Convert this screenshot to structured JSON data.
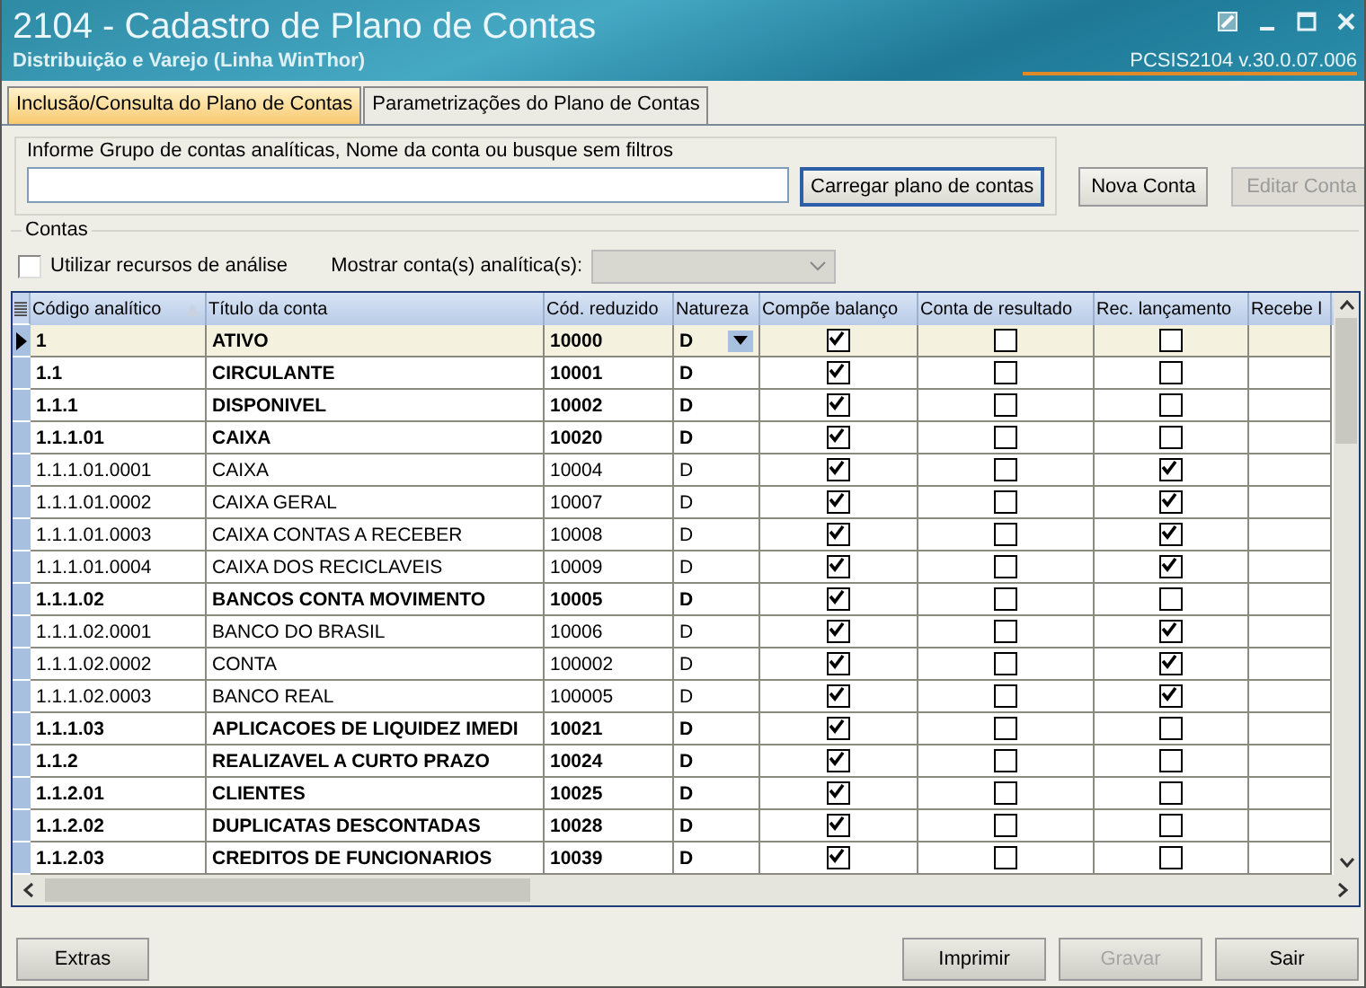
{
  "window": {
    "title": "2104 - Cadastro de Plano de Contas",
    "subtitle": "Distribuição e Varejo (Linha WinThor)",
    "version": "PCSIS2104  v.30.0.07.006"
  },
  "tabs": [
    {
      "label": "Inclusão/Consulta do Plano de Contas",
      "selected": true
    },
    {
      "label": "Parametrizações do Plano de Contas",
      "selected": false
    }
  ],
  "search": {
    "legend": "Informe Grupo de contas analíticas, Nome da conta ou busque sem filtros",
    "buttons": [
      {
        "label": "Carregar plano de contas",
        "disabled": false,
        "focused": true
      },
      {
        "label": "Nova Conta",
        "disabled": false,
        "focused": false
      },
      {
        "label": "Editar Conta",
        "disabled": true,
        "focused": false
      }
    ]
  },
  "accounts": {
    "legend": "Contas",
    "analysis_checkbox": {
      "label": "Utilizar recursos de análise",
      "checked": false
    },
    "show_label": "Mostrar conta(s) analítica(s):",
    "show_combo_disabled": true,
    "columns": [
      {
        "label": "Código analítico",
        "sorted": true
      },
      {
        "label": "Título da conta",
        "sorted": false
      },
      {
        "label": "Cód. reduzido",
        "sorted": false
      },
      {
        "label": "Natureza",
        "sorted": false
      },
      {
        "label": "Compõe balanço",
        "sorted": false
      },
      {
        "label": "Conta de resultado",
        "sorted": false
      },
      {
        "label": "Rec. lançamento",
        "sorted": false
      },
      {
        "label": "Recebe l",
        "sorted": false
      }
    ],
    "rows": [
      {
        "code": "1",
        "title": "ATIVO",
        "reduced": "10000",
        "nature": "D",
        "bold": true,
        "selected": true,
        "balance": true,
        "result": false,
        "posting": false
      },
      {
        "code": "1.1",
        "title": "CIRCULANTE",
        "reduced": "10001",
        "nature": "D",
        "bold": true,
        "selected": false,
        "balance": true,
        "result": false,
        "posting": false
      },
      {
        "code": "1.1.1",
        "title": "DISPONIVEL",
        "reduced": "10002",
        "nature": "D",
        "bold": true,
        "selected": false,
        "balance": true,
        "result": false,
        "posting": false
      },
      {
        "code": "1.1.1.01",
        "title": "CAIXA",
        "reduced": "10020",
        "nature": "D",
        "bold": true,
        "selected": false,
        "balance": true,
        "result": false,
        "posting": false
      },
      {
        "code": "1.1.1.01.0001",
        "title": "CAIXA",
        "reduced": "10004",
        "nature": "D",
        "bold": false,
        "selected": false,
        "balance": true,
        "result": false,
        "posting": true
      },
      {
        "code": "1.1.1.01.0002",
        "title": "CAIXA GERAL",
        "reduced": "10007",
        "nature": "D",
        "bold": false,
        "selected": false,
        "balance": true,
        "result": false,
        "posting": true
      },
      {
        "code": "1.1.1.01.0003",
        "title": "CAIXA CONTAS A RECEBER",
        "reduced": "10008",
        "nature": "D",
        "bold": false,
        "selected": false,
        "balance": true,
        "result": false,
        "posting": true
      },
      {
        "code": "1.1.1.01.0004",
        "title": "CAIXA DOS RECICLAVEIS",
        "reduced": "10009",
        "nature": "D",
        "bold": false,
        "selected": false,
        "balance": true,
        "result": false,
        "posting": true
      },
      {
        "code": "1.1.1.02",
        "title": "BANCOS CONTA MOVIMENTO",
        "reduced": "10005",
        "nature": "D",
        "bold": true,
        "selected": false,
        "balance": true,
        "result": false,
        "posting": false
      },
      {
        "code": "1.1.1.02.0001",
        "title": "BANCO DO BRASIL",
        "reduced": "10006",
        "nature": "D",
        "bold": false,
        "selected": false,
        "balance": true,
        "result": false,
        "posting": true
      },
      {
        "code": "1.1.1.02.0002",
        "title": "CONTA",
        "reduced": "100002",
        "nature": "D",
        "bold": false,
        "selected": false,
        "balance": true,
        "result": false,
        "posting": true
      },
      {
        "code": "1.1.1.02.0003",
        "title": "BANCO REAL",
        "reduced": "100005",
        "nature": "D",
        "bold": false,
        "selected": false,
        "balance": true,
        "result": false,
        "posting": true
      },
      {
        "code": "1.1.1.03",
        "title": "APLICACOES DE LIQUIDEZ IMEDI",
        "reduced": "10021",
        "nature": "D",
        "bold": true,
        "selected": false,
        "balance": true,
        "result": false,
        "posting": false
      },
      {
        "code": "1.1.2",
        "title": "REALIZAVEL A CURTO PRAZO",
        "reduced": "10024",
        "nature": "D",
        "bold": true,
        "selected": false,
        "balance": true,
        "result": false,
        "posting": false
      },
      {
        "code": "1.1.2.01",
        "title": "CLIENTES",
        "reduced": "10025",
        "nature": "D",
        "bold": true,
        "selected": false,
        "balance": true,
        "result": false,
        "posting": false
      },
      {
        "code": "1.1.2.02",
        "title": "DUPLICATAS DESCONTADAS",
        "reduced": "10028",
        "nature": "D",
        "bold": true,
        "selected": false,
        "balance": true,
        "result": false,
        "posting": false
      },
      {
        "code": "1.1.2.03",
        "title": "CREDITOS DE FUNCIONARIOS",
        "reduced": "10039",
        "nature": "D",
        "bold": true,
        "selected": false,
        "balance": true,
        "result": false,
        "posting": false
      }
    ]
  },
  "footer": {
    "left_buttons": [
      {
        "label": "Extras",
        "disabled": false
      }
    ],
    "right_buttons": [
      {
        "label": "Imprimir",
        "disabled": false
      },
      {
        "label": "Gravar",
        "disabled": true
      },
      {
        "label": "Sair",
        "disabled": false
      }
    ]
  }
}
